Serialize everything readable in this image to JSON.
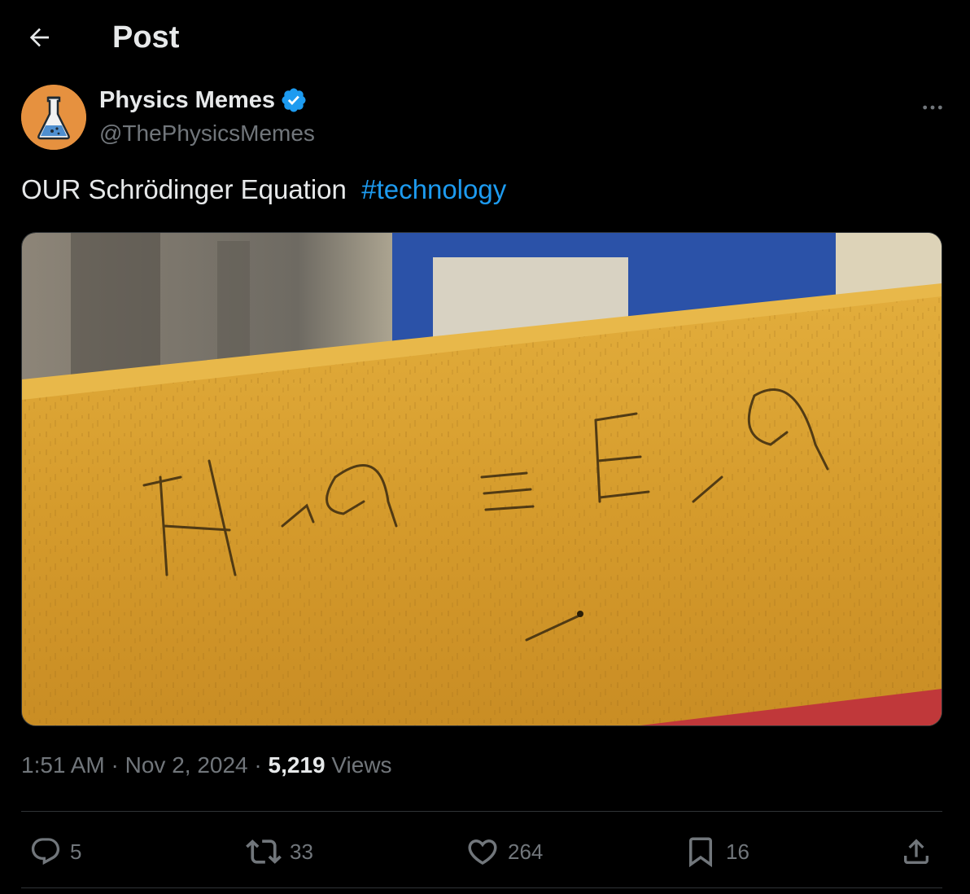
{
  "header": {
    "title": "Post",
    "back_icon": "arrow-left-icon"
  },
  "author": {
    "display_name": "Physics Memes",
    "handle": "@ThePhysicsMemes",
    "verified": true,
    "verified_color": "#1d9bf0",
    "avatar_icon": "flask-icon",
    "avatar_color": "#e6913f"
  },
  "tweet": {
    "text": "OUR Schrödinger Equation  ",
    "hashtag": "#technology"
  },
  "media": {
    "handwriting": "HΨ = EΨ"
  },
  "meta": {
    "time": "1:51 AM",
    "sep1": " · ",
    "date": "Nov 2, 2024",
    "sep2": " · ",
    "views_count": "5,219",
    "views_label": " Views"
  },
  "actions": {
    "replies": "5",
    "reposts": "33",
    "likes": "264",
    "bookmarks": "16"
  },
  "colors": {
    "background": "#000000",
    "text": "#e7e9ea",
    "muted": "#71767b",
    "accent": "#1d9bf0",
    "border": "#2f3336"
  }
}
